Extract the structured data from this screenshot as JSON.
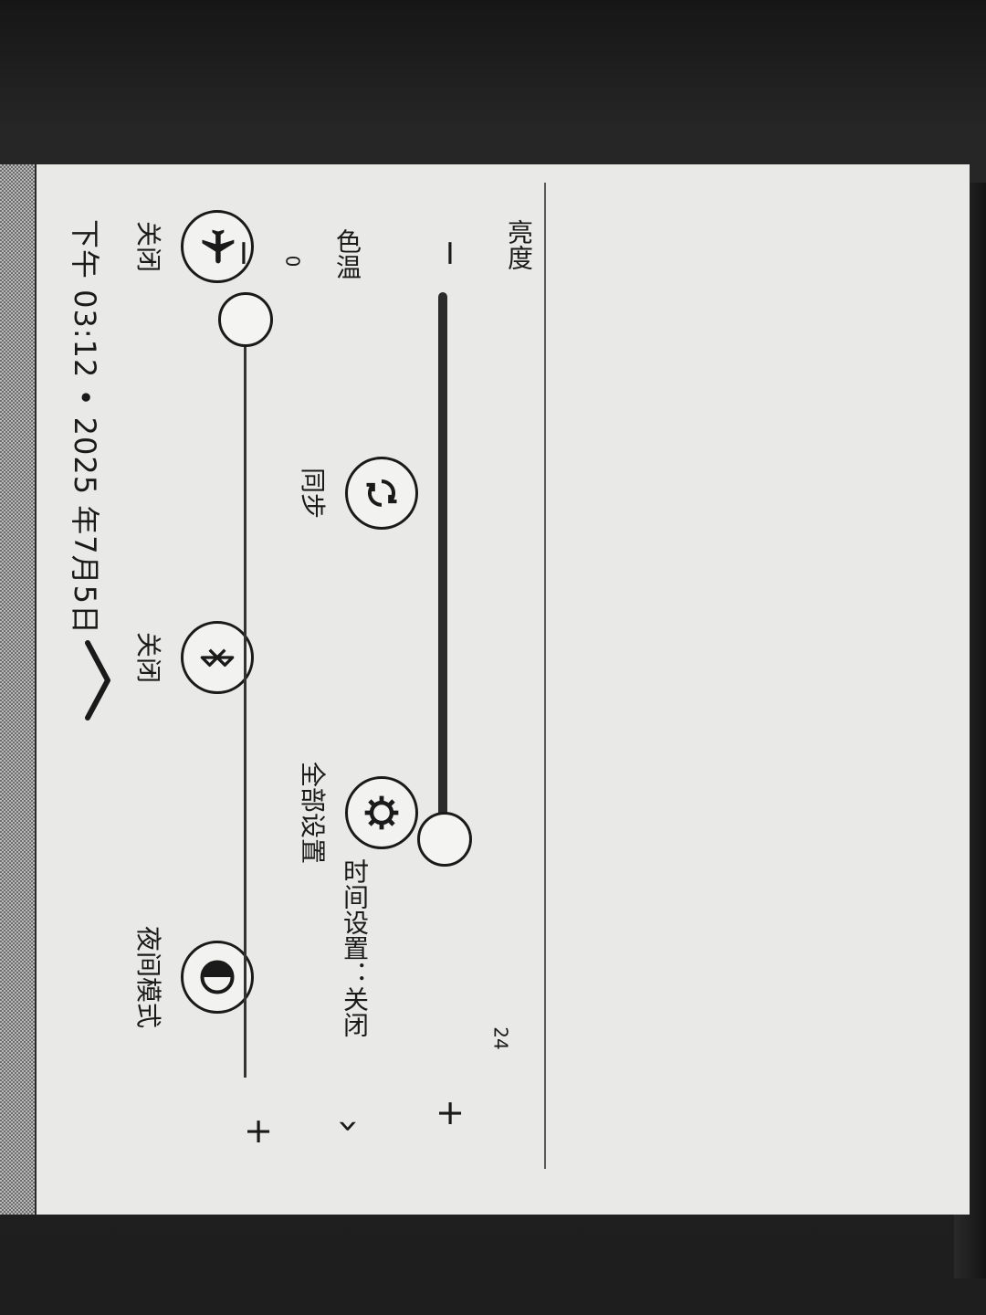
{
  "status": {
    "time": "下午 03:12",
    "separator": "•",
    "date": "2025 年7月5日"
  },
  "quick_toggles": [
    {
      "icon": "airplane-icon",
      "label": "关闭"
    },
    {
      "icon": "bluetooth-icon",
      "label": "关闭"
    },
    {
      "icon": "night-mode-icon",
      "label": "夜间模式"
    },
    {
      "icon": "sync-icon",
      "label": "同步"
    },
    {
      "icon": "gear-icon",
      "label": "全部设置"
    }
  ],
  "brightness": {
    "title": "亮度",
    "value": "24",
    "level": 0.73,
    "minus": "−",
    "plus": "+"
  },
  "color_temp": {
    "title": "色温",
    "value": "0",
    "level": 0.0,
    "minus": "−",
    "plus": "+",
    "schedule_label": "时间设置：",
    "schedule_value": "关闭",
    "schedule_arrow": "›"
  }
}
